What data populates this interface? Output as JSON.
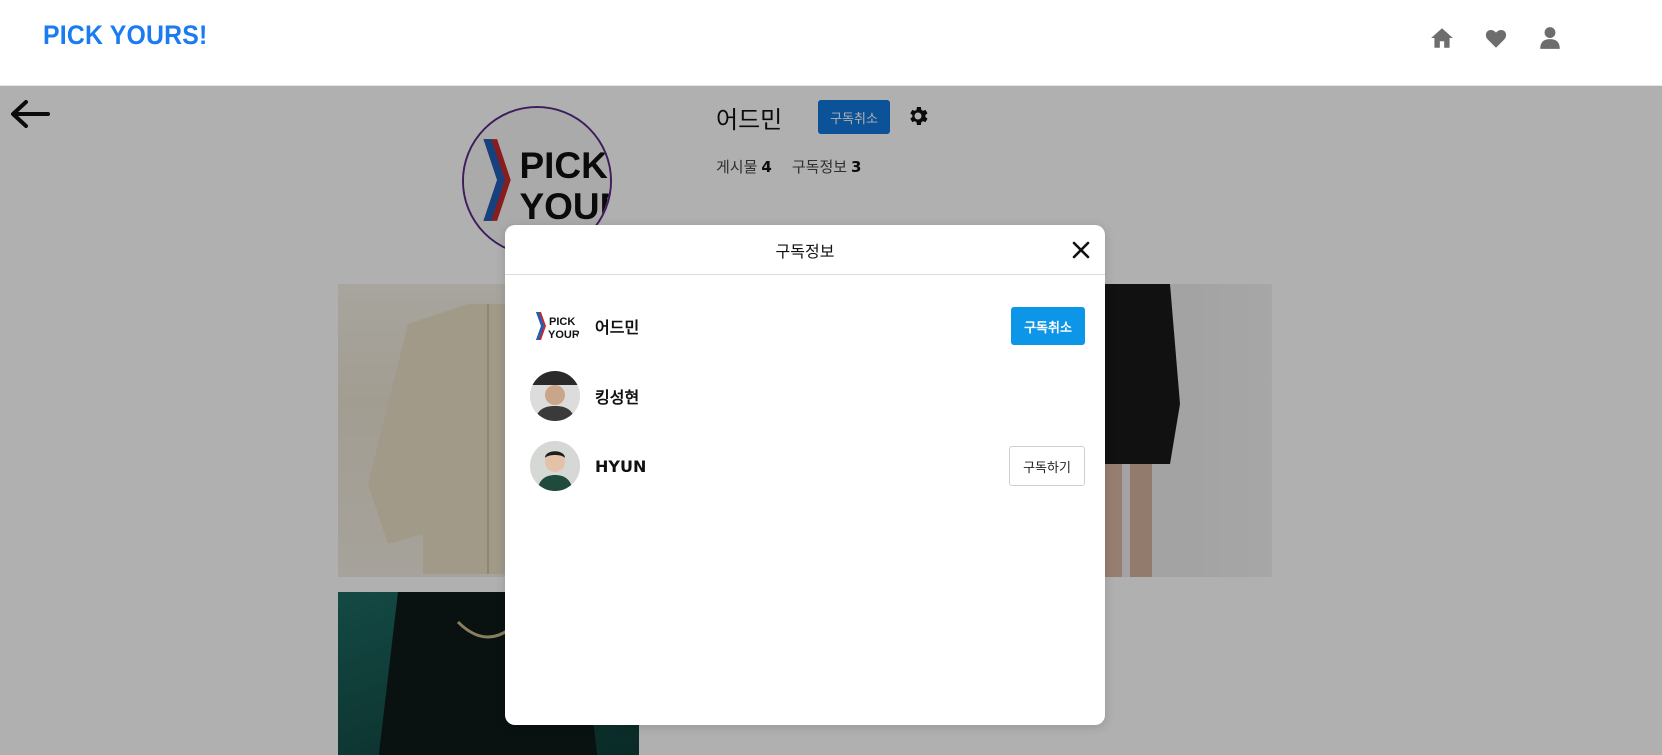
{
  "header": {
    "logo": "PICK YOURS!",
    "nav": [
      {
        "icon": "home-icon"
      },
      {
        "icon": "heart-icon"
      },
      {
        "icon": "user-icon"
      }
    ]
  },
  "profile": {
    "name": "어드민",
    "unsubscribe_label": "구독취소",
    "stats": {
      "posts_label": "게시물",
      "posts_count": "4",
      "subs_label": "구독정보",
      "subs_count": "3"
    },
    "avatar_logo": {
      "line1": "PICK",
      "line2": "YOURS"
    }
  },
  "modal": {
    "title": "구독정보",
    "items": [
      {
        "name": "어드민",
        "action": "구독취소",
        "action_type": "unsubscribe",
        "avatar": "logo"
      },
      {
        "name": "킹성현",
        "action": "",
        "action_type": "none",
        "avatar": "photo"
      },
      {
        "name": "HYUN",
        "action": "구독하기",
        "action_type": "subscribe",
        "avatar": "photo"
      }
    ]
  },
  "colors": {
    "brand": "#1a7cf0",
    "primary_button": "#0d95e8",
    "overlay": "rgba(0,0,0,0.31)"
  }
}
